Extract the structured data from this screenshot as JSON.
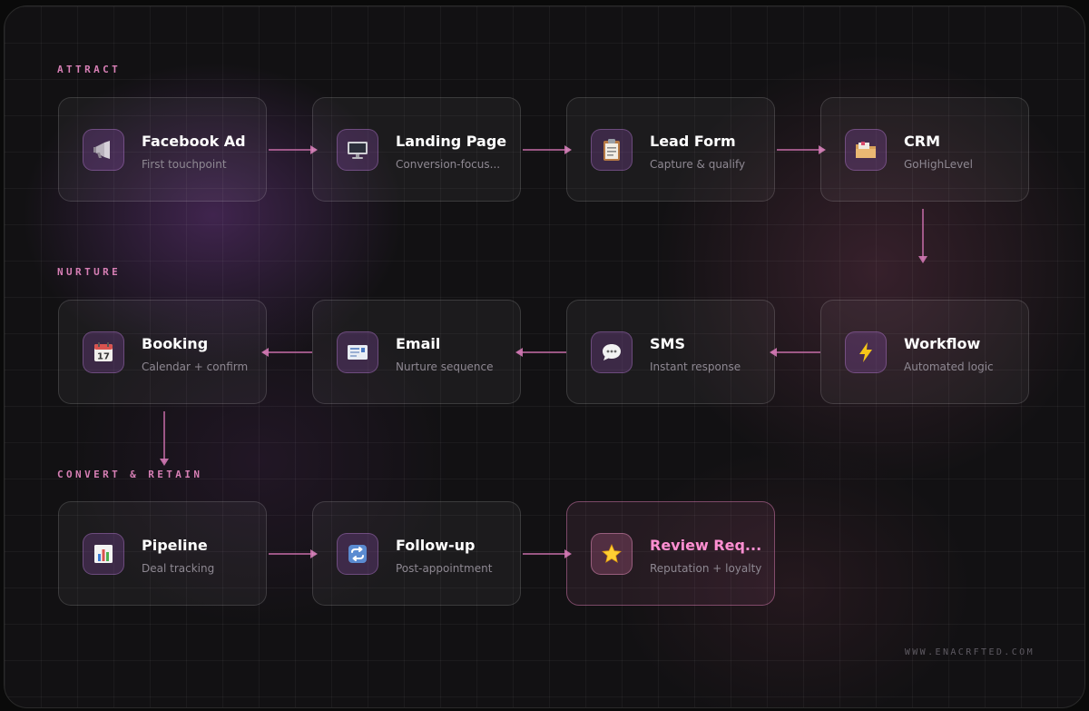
{
  "sections": {
    "attract": "ATTRACT",
    "nurture": "NURTURE",
    "convert": "CONVERT & RETAIN"
  },
  "cards": {
    "facebook_ad": {
      "title": "Facebook Ad",
      "subtitle": "First touchpoint",
      "icon": "megaphone-icon"
    },
    "landing_page": {
      "title": "Landing Page",
      "subtitle": "Conversion-focus...",
      "icon": "monitor-icon"
    },
    "lead_form": {
      "title": "Lead Form",
      "subtitle": "Capture & qualify",
      "icon": "clipboard-icon"
    },
    "crm": {
      "title": "CRM",
      "subtitle": "GoHighLevel",
      "icon": "folder-icon"
    },
    "workflow": {
      "title": "Workflow",
      "subtitle": "Automated logic",
      "icon": "lightning-icon"
    },
    "sms": {
      "title": "SMS",
      "subtitle": "Instant response",
      "icon": "speech-bubble-icon"
    },
    "email": {
      "title": "Email",
      "subtitle": "Nurture sequence",
      "icon": "envelope-icon"
    },
    "booking": {
      "title": "Booking",
      "subtitle": "Calendar + confirm",
      "icon": "calendar-icon",
      "calendar_day": "17"
    },
    "pipeline": {
      "title": "Pipeline",
      "subtitle": "Deal tracking",
      "icon": "bar-chart-icon"
    },
    "follow_up": {
      "title": "Follow-up",
      "subtitle": "Post-appointment",
      "icon": "repeat-icon"
    },
    "review_request": {
      "title": "Review Req...",
      "subtitle": "Reputation + loyalty",
      "icon": "star-icon"
    }
  },
  "footer": "WWW.ENACRFTED.COM",
  "colors": {
    "accent": "#d77fb5",
    "highlight_title": "#ff8fd2",
    "background": "#121113",
    "subtitle": "#8e8892"
  }
}
